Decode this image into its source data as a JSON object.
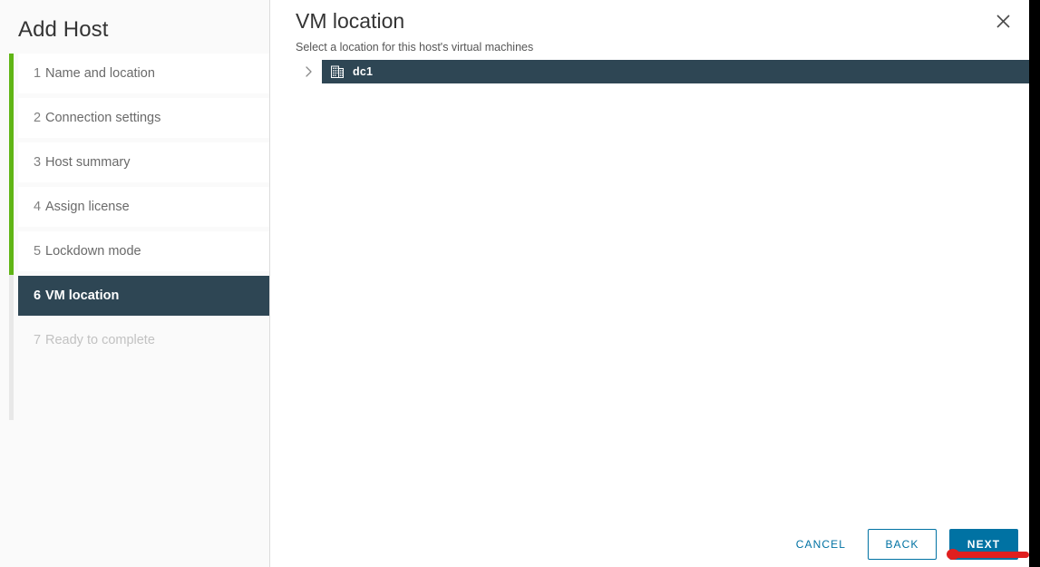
{
  "wizard": {
    "title": "Add Host",
    "steps": [
      {
        "num": "1",
        "label": "Name and location",
        "state": "done"
      },
      {
        "num": "2",
        "label": "Connection settings",
        "state": "done"
      },
      {
        "num": "3",
        "label": "Host summary",
        "state": "done"
      },
      {
        "num": "4",
        "label": "Assign license",
        "state": "done"
      },
      {
        "num": "5",
        "label": "Lockdown mode",
        "state": "done"
      },
      {
        "num": "6",
        "label": "VM location",
        "state": "active"
      },
      {
        "num": "7",
        "label": "Ready to complete",
        "state": "disabled"
      }
    ]
  },
  "content": {
    "page_title": "VM location",
    "subtitle": "Select a location for this host's virtual machines",
    "close_icon": "close-icon"
  },
  "tree": {
    "expand_icon": "chevron-right-icon",
    "nodes": [
      {
        "label": "dc1",
        "icon": "datacenter-icon",
        "selected": true,
        "expandable": true
      }
    ]
  },
  "footer": {
    "cancel_label": "CANCEL",
    "back_label": "BACK",
    "next_label": "NEXT"
  },
  "colors": {
    "accent_done": "#60b515",
    "accent_todo": "#e8e8e8",
    "selected_bg": "#2e4654",
    "primary_button": "#0072a3",
    "annotation": "#e01f1f"
  }
}
